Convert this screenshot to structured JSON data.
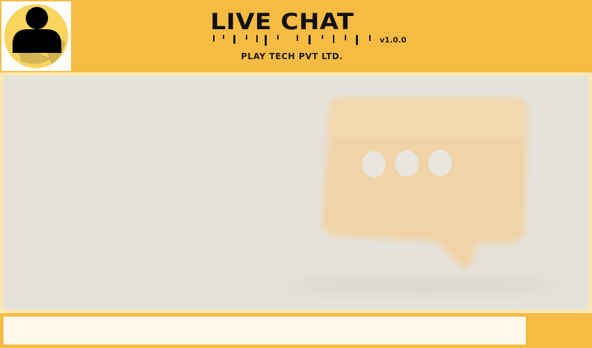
{
  "header": {
    "title": "LIVE CHAT",
    "version": "v1.0.0",
    "company": "PLAY TECH PVT LTD."
  },
  "icons": {
    "avatar": "user-avatar-icon",
    "chat_background": "speech-bubble-typing-icon"
  },
  "colors": {
    "brand": "#f6bb43",
    "avatar_circle": "#f9d45e",
    "chat_background": "#e5e2db",
    "bubble": "#f2d2a4",
    "input_background": "#fdf8ea"
  },
  "composer": {
    "message_value": "",
    "placeholder": ""
  }
}
